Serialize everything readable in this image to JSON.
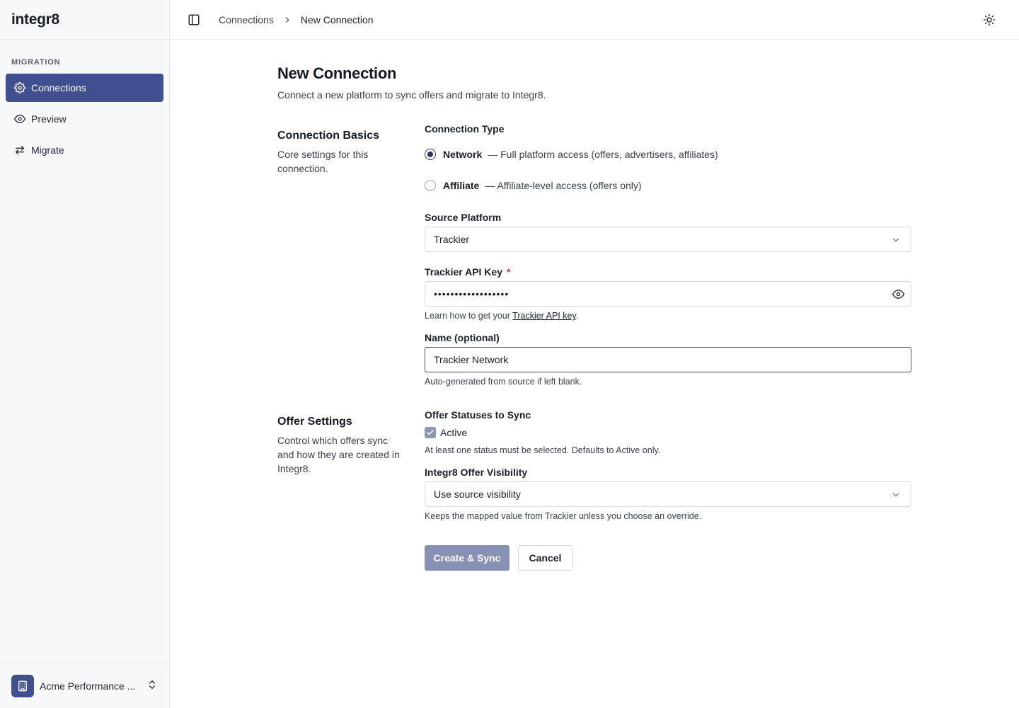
{
  "app": {
    "brand": "integr8"
  },
  "sidebar": {
    "section_label": "MIGRATION",
    "items": [
      {
        "label": "Connections",
        "icon": "gear-icon",
        "active": true
      },
      {
        "label": "Preview",
        "icon": "eye-icon",
        "active": false
      },
      {
        "label": "Migrate",
        "icon": "arrows-swap-icon",
        "active": false
      }
    ],
    "account": {
      "name": "Acme Performance ...",
      "icon": "building-icon"
    }
  },
  "header": {
    "breadcrumb": {
      "parent": "Connections",
      "current": "New Connection"
    }
  },
  "page": {
    "title": "New Connection",
    "subtitle": "Connect a new platform to sync offers and migrate to Integr8."
  },
  "basics": {
    "title": "Connection Basics",
    "description": "Core settings for this connection.",
    "connection_type": {
      "label": "Connection Type",
      "options": [
        {
          "name": "Network",
          "description": "— Full platform access (offers, advertisers, affiliates)",
          "checked": true
        },
        {
          "name": "Affiliate",
          "description": "— Affiliate-level access (offers only)",
          "checked": false
        }
      ]
    },
    "source_platform": {
      "label": "Source Platform",
      "value": "Trackier"
    },
    "api_key": {
      "label": "Trackier API Key",
      "required_mark": "*",
      "value": "••••••••••••••••••",
      "help_prefix": "Learn how to get your ",
      "help_link": "Trackier API key",
      "help_suffix": "."
    },
    "name": {
      "label": "Name (optional)",
      "value": "Trackier Network",
      "help": "Auto-generated from source if left blank."
    }
  },
  "offer_settings": {
    "title": "Offer Settings",
    "description": "Control which offers sync and how they are created in Integr8.",
    "statuses": {
      "label": "Offer Statuses to Sync",
      "options": [
        {
          "label": "Active",
          "checked": true
        }
      ],
      "help": "At least one status must be selected. Defaults to Active only."
    },
    "visibility": {
      "label": "Integr8 Offer Visibility",
      "value": "Use source visibility",
      "help": "Keeps the mapped value from Trackier unless you choose an override."
    }
  },
  "actions": {
    "primary": "Create & Sync",
    "secondary": "Cancel"
  }
}
